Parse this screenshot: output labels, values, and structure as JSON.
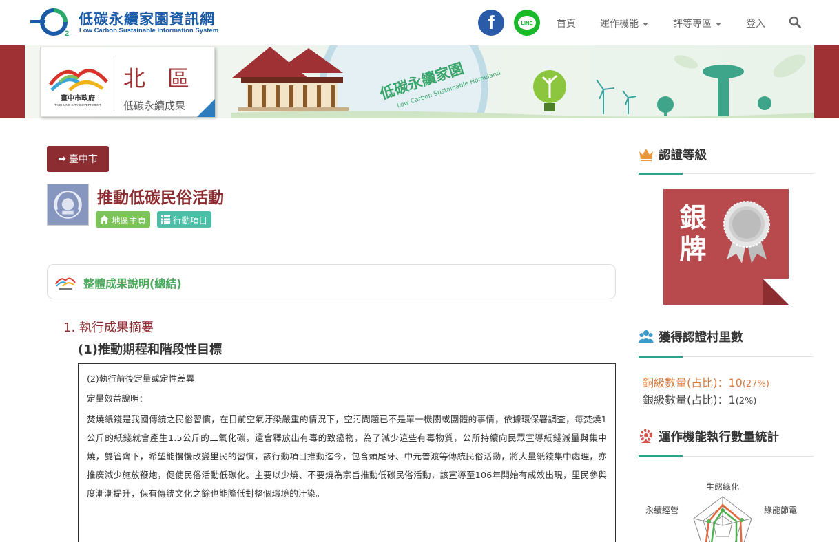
{
  "header": {
    "logo_title": "低碳永續家園資訊網",
    "logo_subtitle": "Low Carbon Sustainable Information System",
    "social": {
      "facebook": "f",
      "line": "LINE"
    },
    "nav": [
      {
        "label": "首頁",
        "has_caret": false
      },
      {
        "label": "運作機能",
        "has_caret": true
      },
      {
        "label": "評等專區",
        "has_caret": true
      },
      {
        "label": "登入",
        "has_caret": false
      }
    ]
  },
  "banner": {
    "region_name": "北區",
    "region_sub": "低碳永續成果",
    "gov_name": "臺中市政府",
    "gov_name_en": "TAICHUNG CITY GOVERNMENT",
    "art_title": "低碳永續家園",
    "art_sub": "Low Carbon Sustainable Homeland"
  },
  "main": {
    "city_button": "臺中市",
    "title": "推動低碳民俗活動",
    "tags": {
      "home": "地區主頁",
      "items": "行動項目"
    },
    "summary_label": "整體成果說明(總結)",
    "section_h1": "1. 執行成果摘要",
    "section_h2": "(1)推動期程和階段性目標",
    "content": {
      "line1": "(2)執行前後定量或定性差異",
      "line2": "定量效益說明：",
      "paragraph": "焚燒紙錢是我國傳統之民俗習慣，在目前空氣汙染嚴重的情況下，空污問題已不是單一機關或團體的事情，依據環保署調查，每焚燒1公斤的紙錢就會產生1.5公斤的二氧化碳，還會釋放出有毒的致癌物，為了減少這些有毒物質，公所持續向民眾宣導紙錢減量與集中燒，雙管齊下，希望能慢慢改變里民的習慣，該行動項目推動迄今，包含頭尾牙、中元普渡等傳統民俗活動，將大量紙錢集中處理，亦推廣減少施放鞭炮，促使民俗活動低碳化。主要以少燒、不要燒為宗旨推動低碳民俗活動，該宣導至106年開始有成效出現，里民參與度漸漸提升，保有傳統文化之餘也能降低對整個環境的汙染。"
    }
  },
  "sidebar": {
    "cert_heading": "認證等級",
    "badge_text": "銀牌",
    "villages_heading": "獲得認證村里數",
    "bronze_label": "銅級數量(占比)：",
    "bronze_value": "10",
    "bronze_pct": "(27%)",
    "silver_label": "銀級數量(占比)：",
    "silver_value": "1",
    "silver_pct": "(2%)",
    "stats_heading": "運作機能執行數量統計",
    "radar_labels": {
      "top": "生態綠化",
      "left": "永續經營",
      "right": "綠能節電"
    }
  },
  "colors": {
    "brand_red": "#8c2d31",
    "brand_blue": "#1a5aa6",
    "accent_green": "#2ca48a",
    "bronze": "#d97b3b"
  },
  "icons": [
    "search-icon",
    "facebook-icon",
    "line-icon",
    "arrow-right-icon",
    "home-icon",
    "list-icon",
    "crown-icon",
    "people-icon",
    "gear-icon",
    "medal-icon"
  ]
}
